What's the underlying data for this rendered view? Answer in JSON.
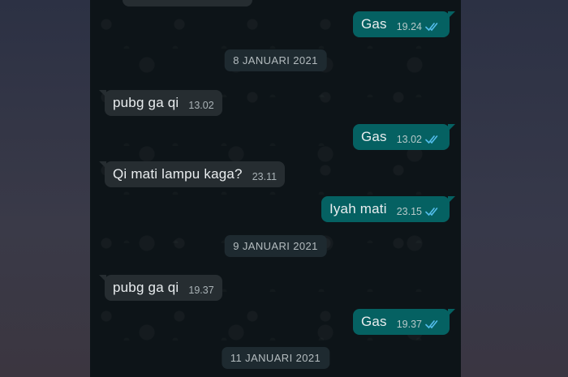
{
  "colors": {
    "chat_background": "#0d1418",
    "incoming_bubble": "#262d31",
    "outgoing_bubble": "#056162",
    "read_ticks": "#53bdeb",
    "date_chip": "#1e2a30"
  },
  "conversation": {
    "msg_1": {
      "text": "Gas",
      "time": "19.24",
      "status_icon": "double-check-read-icon"
    },
    "date_1": "8 JANUARI 2021",
    "msg_2": {
      "text": "pubg ga qi",
      "time": "13.02"
    },
    "msg_3": {
      "text": "Gas",
      "time": "13.02",
      "status_icon": "double-check-read-icon"
    },
    "msg_4": {
      "text": "Qi mati lampu kaga?",
      "time": "23.11"
    },
    "msg_5": {
      "text": "Iyah mati",
      "time": "23.15",
      "status_icon": "double-check-read-icon"
    },
    "date_2": "9 JANUARI 2021",
    "msg_6": {
      "text": "pubg ga qi",
      "time": "19.37"
    },
    "msg_7": {
      "text": "Gas",
      "time": "19.37",
      "status_icon": "double-check-read-icon"
    },
    "date_3": "11 JANUARI 2021"
  }
}
